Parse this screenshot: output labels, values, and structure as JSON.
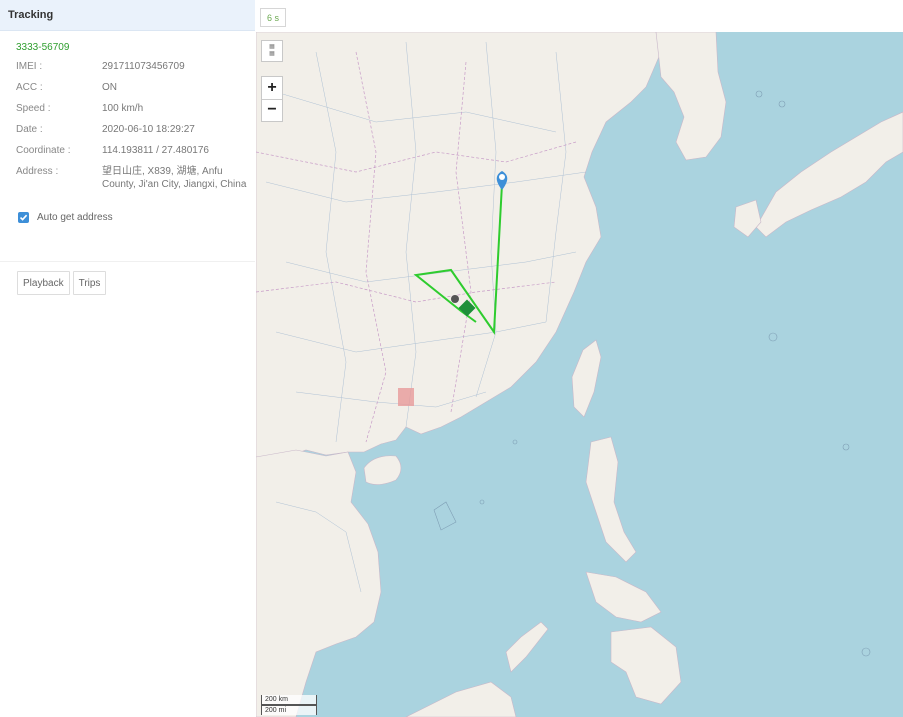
{
  "panel": {
    "title": "Tracking",
    "device_id": "3333-56709",
    "fields": [
      {
        "label": "IMEI :",
        "value": "291711073456709"
      },
      {
        "label": "ACC :",
        "value": "ON"
      },
      {
        "label": "Speed :",
        "value": "100 km/h"
      },
      {
        "label": "Date :",
        "value": "2020-06-10 18:29:27"
      },
      {
        "label": "Coordinate :",
        "value": "114.193811 / 27.480176"
      },
      {
        "label": "Address :",
        "value": "望日山庄, X839, 湖塘, Anfu County, Ji'an City, Jiangxi, China"
      }
    ],
    "auto_address_label": "Auto get address",
    "auto_address_checked": true,
    "buttons": {
      "playback": "Playback",
      "trips": "Trips"
    }
  },
  "refresh_interval": "6 s",
  "map": {
    "zoom_in": "+",
    "zoom_out": "−",
    "layer_icon": "layers-icon",
    "scale_km": "200 km",
    "scale_mi": "200 mi",
    "track_color": "#2ecc2e",
    "marker_color": "#3d8fd8",
    "water_color": "#aad3df",
    "land_color": "#f2efe9"
  }
}
